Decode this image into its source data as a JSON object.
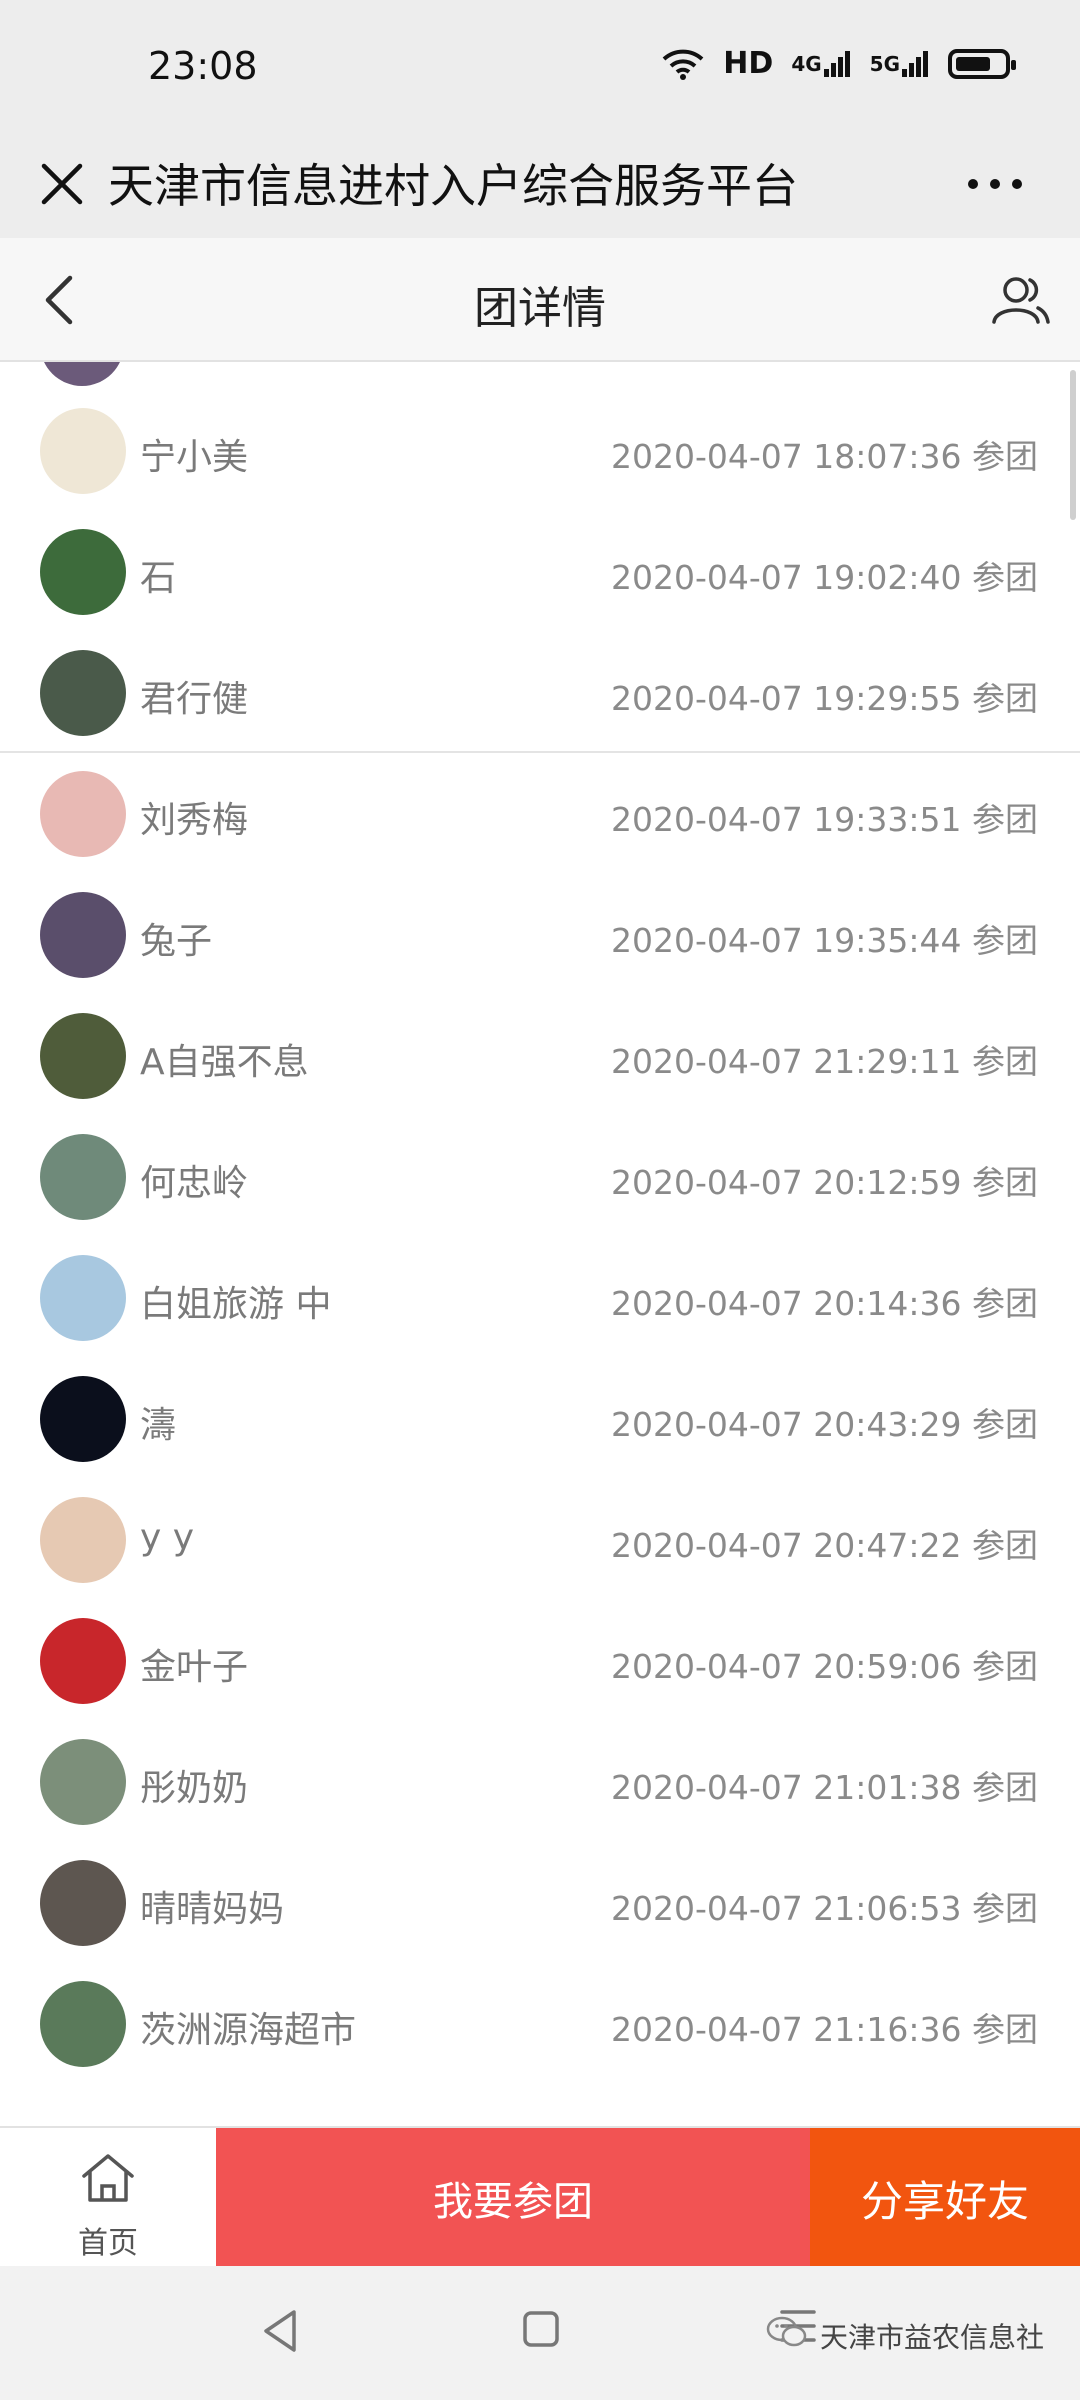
{
  "status_bar": {
    "time": "23:08",
    "hd_label": "HD",
    "net1": "4G",
    "net2": "5G"
  },
  "wechat_bar": {
    "title": "天津市信息进村入户综合服务平台"
  },
  "page": {
    "title": "团详情"
  },
  "members": [
    {
      "name": "宁小美",
      "time": "2020-04-07 18:07:36 参团",
      "avatar_color": "#efe7d6"
    },
    {
      "name": "石",
      "time": "2020-04-07 19:02:40 参团",
      "avatar_color": "#3d6b3b"
    },
    {
      "name": "君行健",
      "time": "2020-04-07 19:29:55 参团",
      "avatar_color": "#4a5a4a"
    },
    {
      "name": "刘秀梅",
      "time": "2020-04-07 19:33:51 参团",
      "avatar_color": "#e8b9b4"
    },
    {
      "name": "兔子",
      "time": "2020-04-07 19:35:44 参团",
      "avatar_color": "#5a4e6b"
    },
    {
      "name": "A自强不息",
      "time": "2020-04-07 21:29:11 参团",
      "avatar_color": "#4f5c3a"
    },
    {
      "name": "何忠岭",
      "time": "2020-04-07 20:12:59 参团",
      "avatar_color": "#6f8a7a"
    },
    {
      "name": "白姐旅游 中",
      "time": "2020-04-07 20:14:36 参团",
      "avatar_color": "#a8c8e0"
    },
    {
      "name": "濤",
      "time": "2020-04-07 20:43:29 参团",
      "avatar_color": "#0b0f1c"
    },
    {
      "name": "y y",
      "time": "2020-04-07 20:47:22 参团",
      "avatar_color": "#e6c9b3"
    },
    {
      "name": "金叶子",
      "time": "2020-04-07 20:59:06 参团",
      "avatar_color": "#c8262b"
    },
    {
      "name": "彤奶奶",
      "time": "2020-04-07 21:01:38 参团",
      "avatar_color": "#7c8f7a"
    },
    {
      "name": "晴晴妈妈",
      "time": "2020-04-07 21:06:53 参团",
      "avatar_color": "#5d5650"
    },
    {
      "name": "茨洲源海超市",
      "time": "2020-04-07 21:16:36 参团",
      "avatar_color": "#5a7a5a"
    }
  ],
  "action_bar": {
    "home_label": "首页",
    "join_label": "我要参团",
    "share_label": "分享好友"
  },
  "watermark": {
    "text": "天津市益农信息社"
  },
  "colors": {
    "join_button": "#f25353",
    "share_button": "#f2550f"
  }
}
